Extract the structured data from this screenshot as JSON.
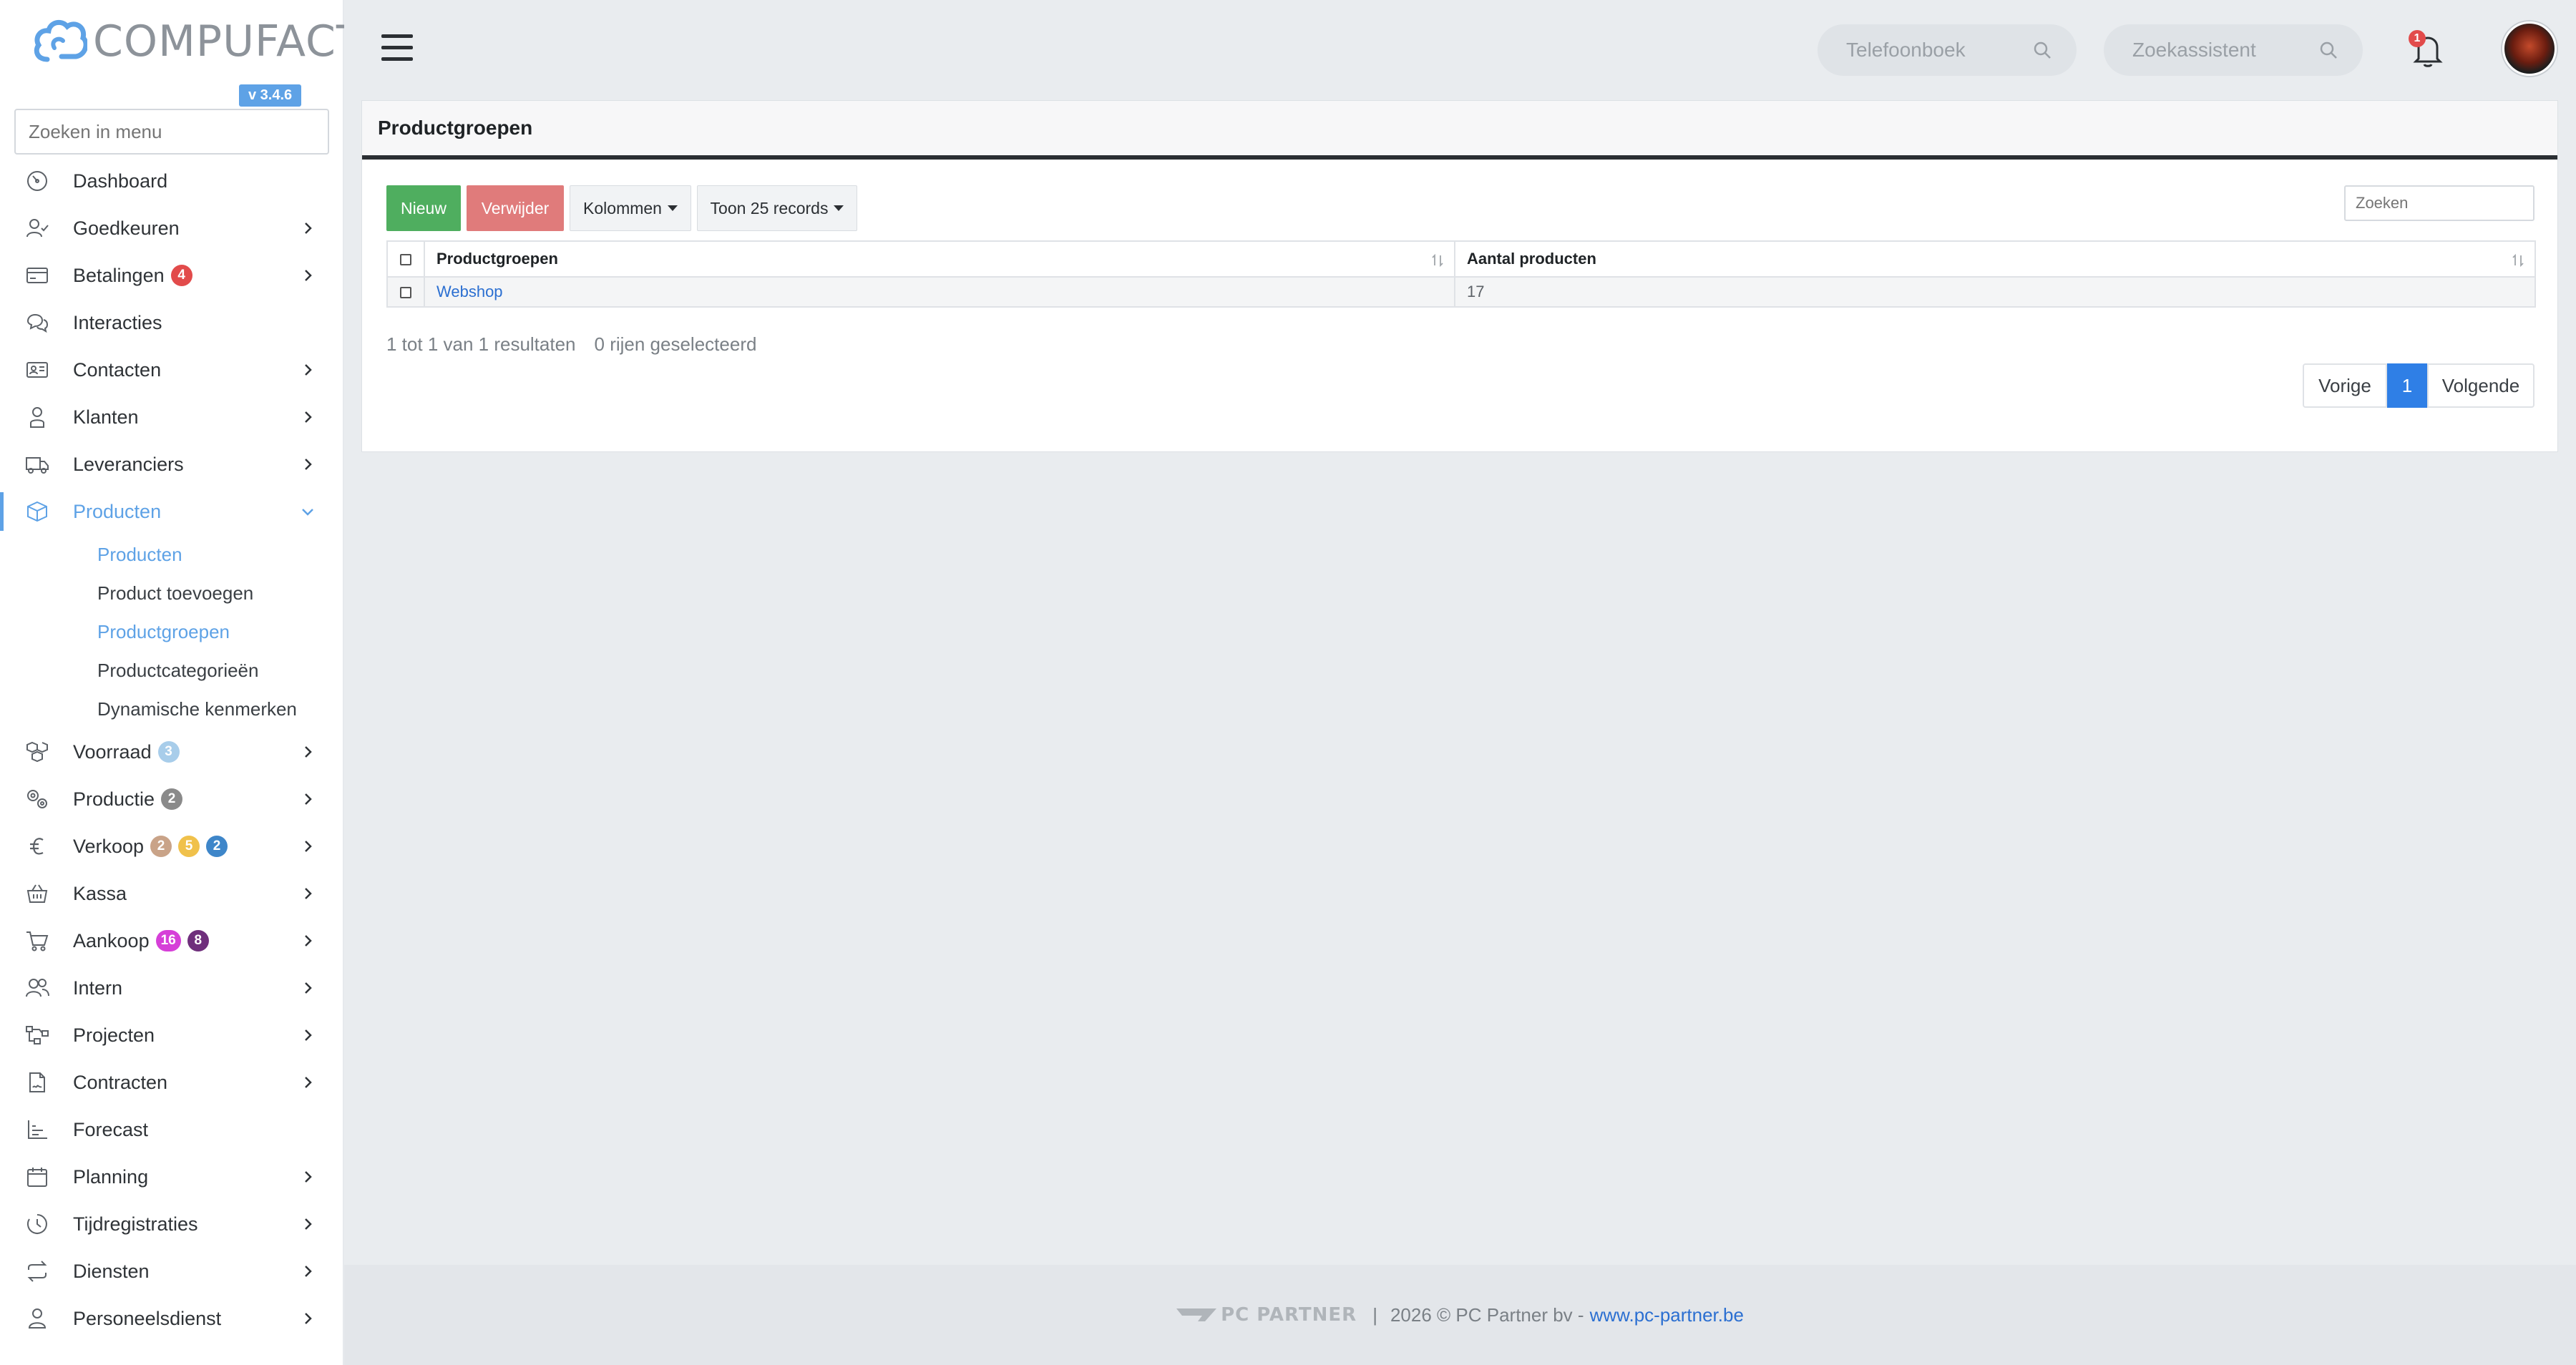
{
  "app": {
    "logo_text": "COMPUFACT",
    "version": "v 3.4.6",
    "menu_search_placeholder": "Zoeken in menu"
  },
  "sidebar": {
    "items": [
      {
        "label": "Dashboard",
        "icon": "dashboard-icon"
      },
      {
        "label": "Goedkeuren",
        "icon": "user-check-icon"
      },
      {
        "label": "Betalingen",
        "icon": "credit-card-icon",
        "badges": [
          {
            "value": "4",
            "color": "#e24b4b"
          }
        ]
      },
      {
        "label": "Interacties",
        "icon": "chat-icon"
      },
      {
        "label": "Contacten",
        "icon": "contact-card-icon"
      },
      {
        "label": "Klanten",
        "icon": "customer-icon"
      },
      {
        "label": "Leveranciers",
        "icon": "truck-icon"
      },
      {
        "label": "Producten",
        "icon": "box-icon"
      },
      {
        "label": "Voorraad",
        "icon": "stock-boxes-icon",
        "badges": [
          {
            "value": "3",
            "color": "#a8cdea"
          }
        ]
      },
      {
        "label": "Productie",
        "icon": "gears-icon",
        "badges": [
          {
            "value": "2",
            "color": "#8a8a8a"
          }
        ]
      },
      {
        "label": "Verkoop",
        "icon": "euro-icon",
        "badges": [
          {
            "value": "2",
            "color": "#c9a388"
          },
          {
            "value": "5",
            "color": "#f0c14b"
          },
          {
            "value": "2",
            "color": "#3e86c9"
          }
        ]
      },
      {
        "label": "Kassa",
        "icon": "basket-icon"
      },
      {
        "label": "Aankoop",
        "icon": "cart-icon",
        "badges": [
          {
            "value": "16",
            "color": "#d63fd8"
          },
          {
            "value": "8",
            "color": "#6f2f7c"
          }
        ]
      },
      {
        "label": "Intern",
        "icon": "users-icon"
      },
      {
        "label": "Projecten",
        "icon": "project-icon"
      },
      {
        "label": "Contracten",
        "icon": "contract-icon"
      },
      {
        "label": "Forecast",
        "icon": "chart-icon"
      },
      {
        "label": "Planning",
        "icon": "calendar-icon"
      },
      {
        "label": "Tijdregistraties",
        "icon": "timer-icon"
      },
      {
        "label": "Diensten",
        "icon": "repeat-icon"
      },
      {
        "label": "Personeelsdienst",
        "icon": "person-icon"
      }
    ],
    "sub_items": [
      {
        "label": "Producten",
        "active": true
      },
      {
        "label": "Product toevoegen",
        "active": false
      },
      {
        "label": "Productgroepen",
        "active": true
      },
      {
        "label": "Productcategorieën",
        "active": false
      },
      {
        "label": "Dynamische kenmerken",
        "active": false
      }
    ]
  },
  "topbar": {
    "phonebook_placeholder": "Telefoonboek",
    "assistant_placeholder": "Zoekassistent",
    "notification_count": "1"
  },
  "page": {
    "title": "Productgroepen",
    "buttons": {
      "new": "Nieuw",
      "delete": "Verwijder",
      "columns": "Kolommen",
      "show_records": "Toon 25 records"
    },
    "search_placeholder": "Zoeken",
    "table": {
      "headers": [
        "Productgroepen",
        "Aantal producten"
      ],
      "rows": [
        {
          "name": "Webshop",
          "count": "17"
        }
      ]
    },
    "result_info": "1 tot 1 van 1 resultaten",
    "selected_info": "0 rijen geselecteerd",
    "pagination": {
      "prev": "Vorige",
      "current": "1",
      "next": "Volgende"
    }
  },
  "footer": {
    "brand": "PC PARTNER",
    "separator": "|",
    "copyright": "2026 © PC Partner bv -",
    "link": "www.pc-partner.be"
  },
  "colors": {
    "accent": "#5ea2e6",
    "success": "#4fae5f",
    "danger": "#e07b7b",
    "primary": "#2f7fe6"
  }
}
